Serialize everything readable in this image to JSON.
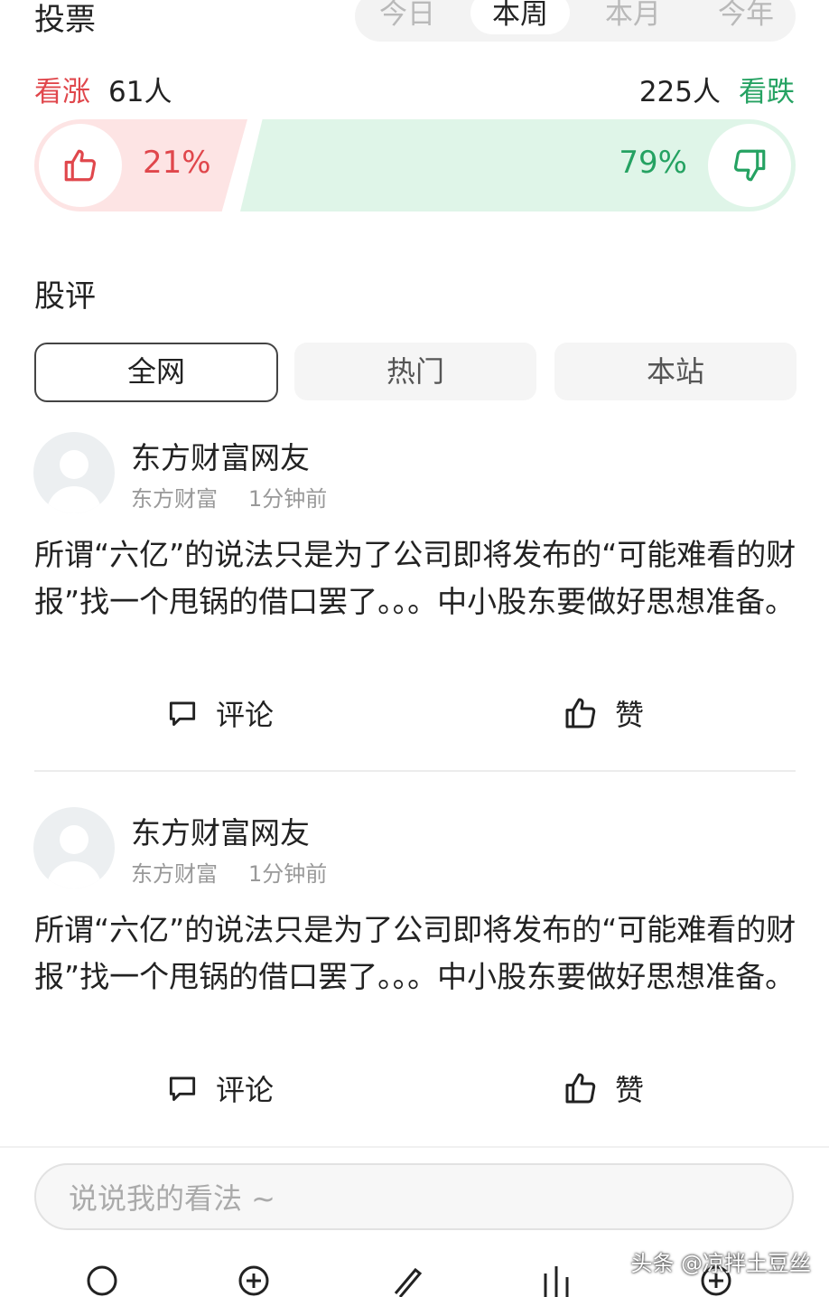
{
  "header": {
    "title": "投票",
    "periods": [
      "今日",
      "本周",
      "本月",
      "今年"
    ],
    "active_period": "本周"
  },
  "vote": {
    "bull_label": "看涨",
    "bull_count": "61人",
    "bear_count": "225人",
    "bear_label": "看跌",
    "bull_pct_text": "21%",
    "bear_pct_text": "79%",
    "bull_fraction": 0.21,
    "colors": {
      "bull": "#e0474c",
      "bear": "#25a262"
    }
  },
  "comments_section": {
    "title": "股评",
    "tabs": [
      "全网",
      "热门",
      "本站"
    ],
    "active_tab": "全网"
  },
  "posts": [
    {
      "author": "东方财富网友",
      "source": "东方财富",
      "time": "1分钟前",
      "text": "所谓“六亿”的说法只是为了公司即将发布的“可能难看的财报”找一个甩锅的借口罢了。。。中小股东要做好思想准备。",
      "comment_label": "评论",
      "like_label": "赞"
    },
    {
      "author": "东方财富网友",
      "source": "东方财富",
      "time": "1分钟前",
      "text": "所谓“六亿”的说法只是为了公司即将发布的“可能难看的财报”找一个甩锅的借口罢了。。。中小股东要做好思想准备。",
      "comment_label": "评论",
      "like_label": "赞"
    }
  ],
  "composer": {
    "placeholder": "说说我的看法 ~"
  },
  "watermark": "头条 @凉拌土豆丝",
  "toolbar_icons": [
    "search-icon",
    "add-circle-icon",
    "edit-icon",
    "chart-icon",
    "add-icon"
  ]
}
